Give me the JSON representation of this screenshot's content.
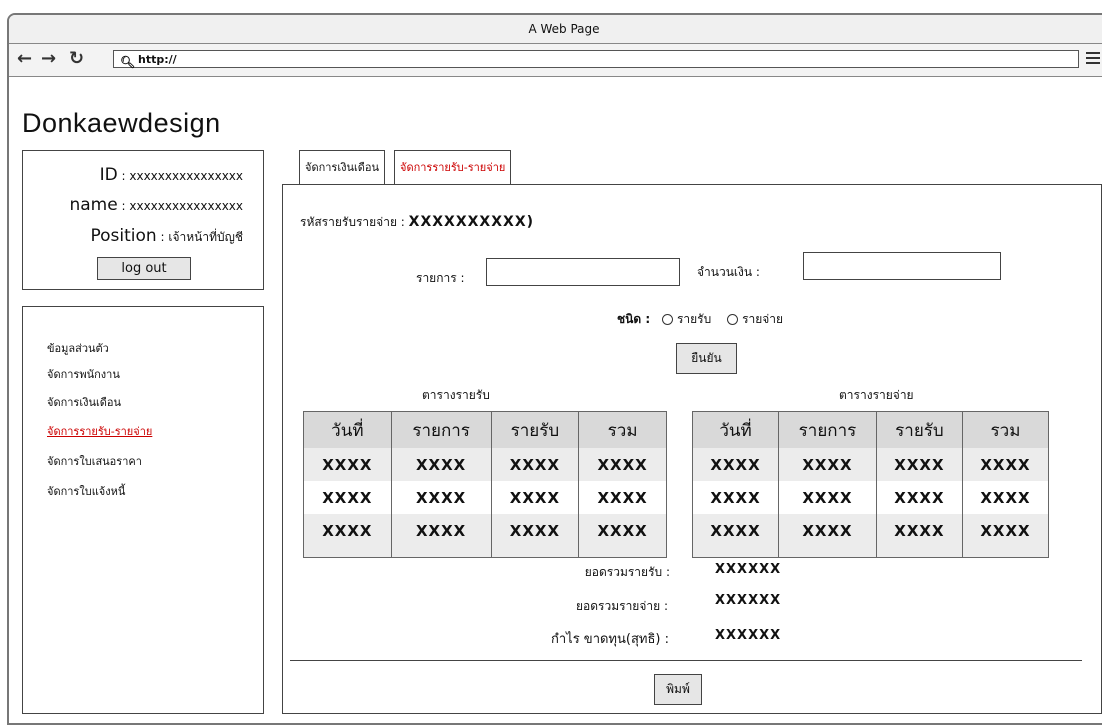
{
  "browser": {
    "title": "A Web Page",
    "url": "http://"
  },
  "brand": "Donkaewdesign",
  "profile": {
    "id_label": "ID",
    "id_value": "xxxxxxxxxxxxxxxx",
    "name_label": "name",
    "name_value": "xxxxxxxxxxxxxxxx",
    "position_label": "Position",
    "position_value": "เจ้าหน้าที่บัญชี",
    "logout_label": "log out"
  },
  "sidebar": {
    "items": [
      {
        "label": "ข้อมูลส่วนตัว"
      },
      {
        "label": "จัดการพนักงาน"
      },
      {
        "label": "จัดการเงินเดือน"
      },
      {
        "label": "จัดการรายรับ-รายจ่าย",
        "active": true
      },
      {
        "label": "จัดการใบเสนอราคา"
      },
      {
        "label": "จัดการใบแจ้งหนี้"
      }
    ]
  },
  "tabs": [
    {
      "label": "จัดการเงินเดือน"
    },
    {
      "label": "จัดการรายรับ-รายจ่าย",
      "active": true
    }
  ],
  "form": {
    "code_label": "รหัสรายรับรายจ่าย :",
    "code_value": "XXXXXXXXXX)",
    "item_label": "รายการ :",
    "amount_label": "จำนวนเงิน :",
    "type_label": "ชนิด :",
    "type_options": [
      "รายรับ",
      "รายจ่าย"
    ],
    "confirm_label": "ยืนยัน"
  },
  "income_table": {
    "caption": "ตารางรายรับ",
    "headers": [
      "วันที่",
      "รายการ",
      "รายรับ",
      "รวม"
    ],
    "rows": [
      [
        "XXXX",
        "XXXX",
        "XXXX",
        "XXXX"
      ],
      [
        "XXXX",
        "XXXX",
        "XXXX",
        "XXXX"
      ],
      [
        "XXXX",
        "XXXX",
        "XXXX",
        "XXXX"
      ]
    ]
  },
  "expense_table": {
    "caption": "ตารางรายจ่าย",
    "headers": [
      "วันที่",
      "รายการ",
      "รายรับ",
      "รวม"
    ],
    "rows": [
      [
        "XXXX",
        "XXXX",
        "XXXX",
        "XXXX"
      ],
      [
        "XXXX",
        "XXXX",
        "XXXX",
        "XXXX"
      ],
      [
        "XXXX",
        "XXXX",
        "XXXX",
        "XXXX"
      ]
    ]
  },
  "summary": {
    "total_income_label": "ยอดรวมรายรับ :",
    "total_income_value": "XXXXXX",
    "total_expense_label": "ยอดรวมรายจ่าย :",
    "total_expense_value": "XXXXXX",
    "profit_label": "กำไร ขาดทุน(สุทธิ) :",
    "profit_value": "XXXXXX"
  },
  "print_label": "พิมพ์"
}
